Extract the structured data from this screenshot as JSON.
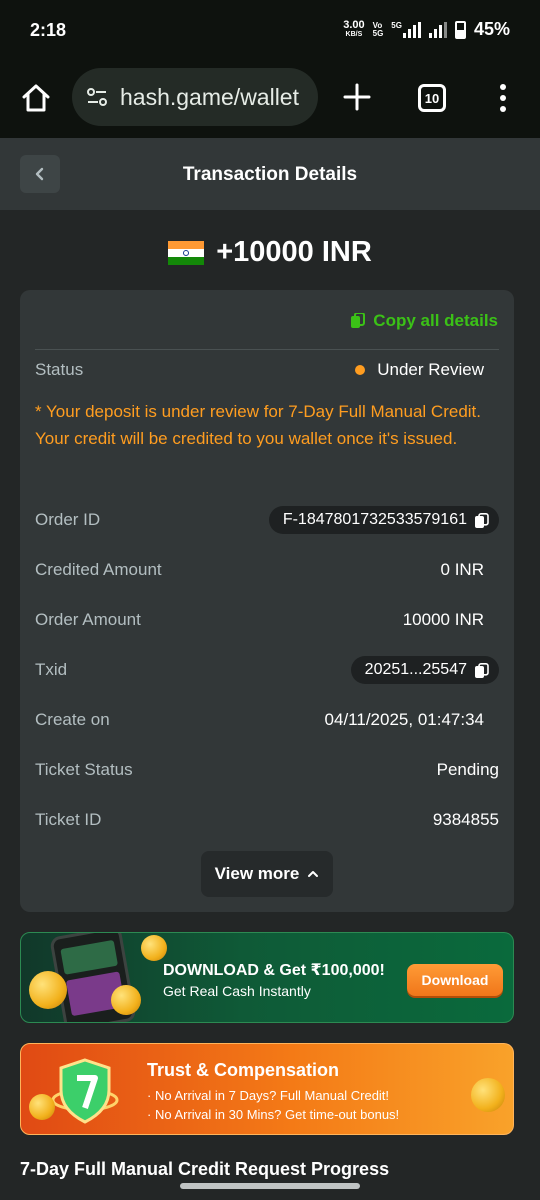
{
  "status_bar": {
    "time": "2:18",
    "net_speed_value": "3.00",
    "net_speed_unit": "KB/S",
    "network_label": "5G",
    "battery": "45%"
  },
  "browser": {
    "url": "hash.game/wallet",
    "tab_count": "10"
  },
  "header": {
    "title": "Transaction Details"
  },
  "amount": {
    "value": "+10000 INR",
    "flag": "india-flag-icon"
  },
  "details": {
    "copy_all_label": "Copy all details",
    "status_label": "Status",
    "status_value": "Under Review",
    "notice": "* Your deposit is under review for 7-Day Full Manual Credit. Your credit will be credited to you wallet once it's issued.",
    "rows": [
      {
        "label": "Order ID",
        "value": "F-1847801732533579161"
      },
      {
        "label": "Credited Amount",
        "value": "0 INR"
      },
      {
        "label": "Order Amount",
        "value": "10000 INR"
      },
      {
        "label": "Txid",
        "value": "20251...25547"
      },
      {
        "label": "Create on",
        "value": "04/11/2025, 01:47:34"
      },
      {
        "label": "Ticket Status",
        "value": "Pending"
      },
      {
        "label": "Ticket ID",
        "value": "9384855"
      }
    ],
    "view_more_label": "View more"
  },
  "download_banner": {
    "title": "DOWNLOAD & Get ₹100,000!",
    "subtitle": "Get Real Cash Instantly",
    "button_label": "Download"
  },
  "trust_banner": {
    "title": "Trust & Compensation",
    "line1": "· No Arrival in 7 Days? Full Manual Credit!",
    "line2": "· No Arrival in 30 Mins? Get time-out bonus!"
  },
  "progress": {
    "title": "7-Day Full Manual Credit Request Progress"
  },
  "colors": {
    "accent_green": "#3bc117",
    "warning_orange": "#ff9d20",
    "card_bg": "#323738",
    "page_bg": "#232626"
  }
}
